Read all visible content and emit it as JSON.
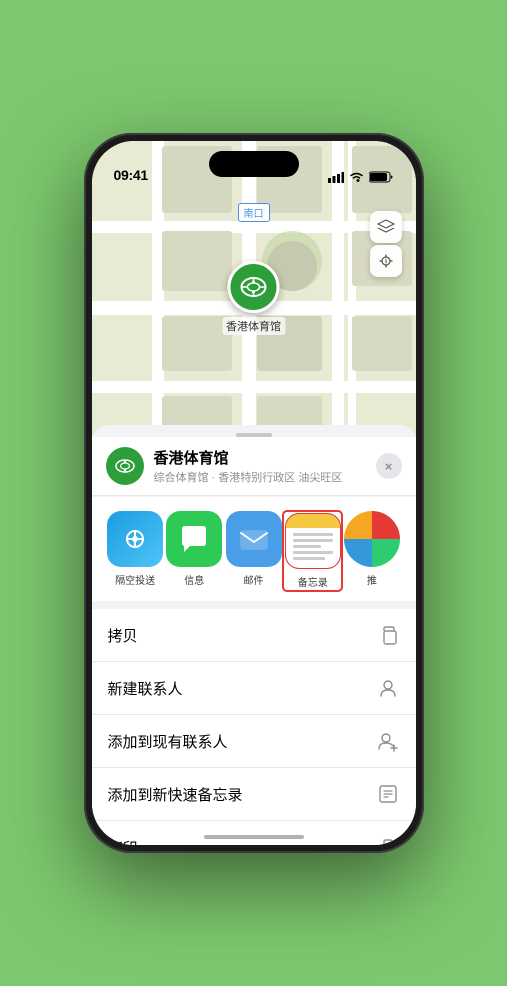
{
  "status_bar": {
    "time": "09:41",
    "location_arrow": "▶"
  },
  "map": {
    "label": "南口",
    "pin_label": "香港体育馆"
  },
  "location_card": {
    "name": "香港体育馆",
    "detail": "综合体育馆 · 香港特别行政区 油尖旺区",
    "close_label": "×"
  },
  "share_items": [
    {
      "id": "airdrop",
      "label": "隔空投送",
      "type": "airdrop"
    },
    {
      "id": "message",
      "label": "信息",
      "type": "message"
    },
    {
      "id": "mail",
      "label": "邮件",
      "type": "mail"
    },
    {
      "id": "notes",
      "label": "备忘录",
      "type": "notes"
    },
    {
      "id": "more",
      "label": "推",
      "type": "more"
    }
  ],
  "actions": [
    {
      "id": "copy",
      "label": "拷贝",
      "icon": "copy"
    },
    {
      "id": "new-contact",
      "label": "新建联系人",
      "icon": "person"
    },
    {
      "id": "add-existing",
      "label": "添加到现有联系人",
      "icon": "person-add"
    },
    {
      "id": "add-notes",
      "label": "添加到新快速备忘录",
      "icon": "quick-note"
    },
    {
      "id": "print",
      "label": "打印",
      "icon": "printer"
    }
  ]
}
